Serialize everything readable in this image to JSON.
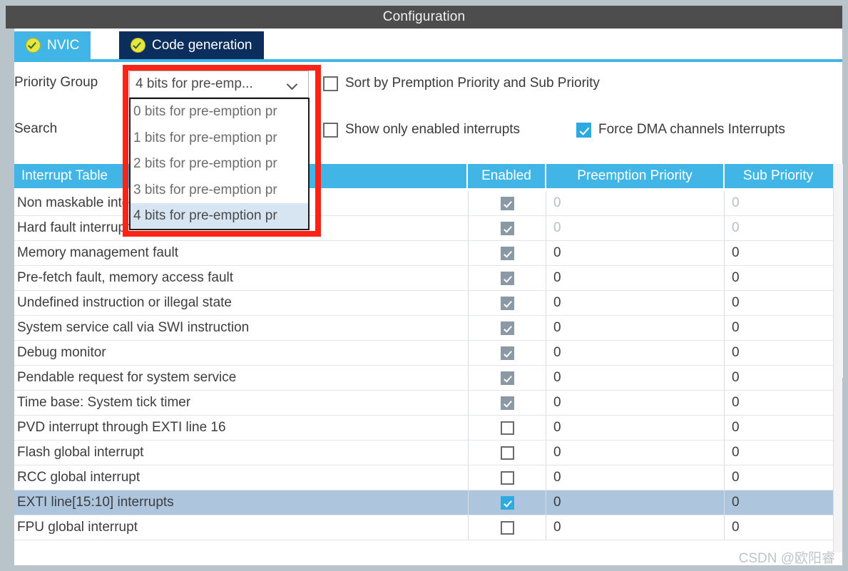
{
  "window": {
    "title": "Configuration"
  },
  "tabs": [
    {
      "label": "NVIC",
      "active": true,
      "icon": "check-circle-icon"
    },
    {
      "label": "Code generation",
      "active": false,
      "icon": "check-circle-icon"
    }
  ],
  "controls": {
    "priority_group_label": "Priority Group",
    "search_label": "Search",
    "priority_group_value": "4 bits for pre-emp...",
    "priority_group_options": [
      "0 bits for pre-emption pr",
      "1 bits for pre-emption pr",
      "2 bits for pre-emption pr",
      "3 bits for pre-emption pr",
      "4 bits for pre-emption pr"
    ],
    "priority_group_selected_index": 4,
    "checkboxes": [
      {
        "label": "Sort by Premption Priority and Sub Priority",
        "checked": false
      },
      {
        "label": "Show only enabled interrupts",
        "checked": false
      },
      {
        "label": "Force DMA channels Interrupts",
        "checked": true
      }
    ]
  },
  "table": {
    "headers": [
      "Interrupt Table",
      "Enabled",
      "Preemption Priority",
      "Sub Priority"
    ],
    "rows": [
      {
        "name": "Non maskable interrupt",
        "enabled": true,
        "locked": true,
        "preemption": "0",
        "sub": "0",
        "selected": false
      },
      {
        "name": "Hard fault interrupt",
        "enabled": true,
        "locked": true,
        "preemption": "0",
        "sub": "0",
        "selected": false
      },
      {
        "name": "Memory management fault",
        "enabled": true,
        "locked": false,
        "preemption": "0",
        "sub": "0",
        "selected": false
      },
      {
        "name": "Pre-fetch fault, memory access fault",
        "enabled": true,
        "locked": false,
        "preemption": "0",
        "sub": "0",
        "selected": false
      },
      {
        "name": "Undefined instruction or illegal state",
        "enabled": true,
        "locked": false,
        "preemption": "0",
        "sub": "0",
        "selected": false
      },
      {
        "name": "System service call via SWI instruction",
        "enabled": true,
        "locked": false,
        "preemption": "0",
        "sub": "0",
        "selected": false
      },
      {
        "name": "Debug monitor",
        "enabled": true,
        "locked": false,
        "preemption": "0",
        "sub": "0",
        "selected": false
      },
      {
        "name": "Pendable request for system service",
        "enabled": true,
        "locked": false,
        "preemption": "0",
        "sub": "0",
        "selected": false
      },
      {
        "name": "Time base: System tick timer",
        "enabled": true,
        "locked": false,
        "preemption": "0",
        "sub": "0",
        "selected": false
      },
      {
        "name": "PVD interrupt through EXTI line 16",
        "enabled": false,
        "locked": false,
        "preemption": "0",
        "sub": "0",
        "selected": false
      },
      {
        "name": "Flash global interrupt",
        "enabled": false,
        "locked": false,
        "preemption": "0",
        "sub": "0",
        "selected": false
      },
      {
        "name": "RCC global interrupt",
        "enabled": false,
        "locked": false,
        "preemption": "0",
        "sub": "0",
        "selected": false
      },
      {
        "name": "EXTI line[15:10] interrupts",
        "enabled": true,
        "locked": false,
        "preemption": "0",
        "sub": "0",
        "selected": true
      },
      {
        "name": "FPU global interrupt",
        "enabled": false,
        "locked": false,
        "preemption": "0",
        "sub": "0",
        "selected": false
      }
    ]
  },
  "watermark": {
    "text": "CSDN @欧阳睿"
  },
  "colors": {
    "accent": "#41b6e6",
    "tab_inactive": "#0b2e5c",
    "titlebar": "#4d4d4d",
    "selection": "#aec6dd",
    "highlight_box": "#fb2316",
    "checkbox_on": "#2eaae0"
  }
}
